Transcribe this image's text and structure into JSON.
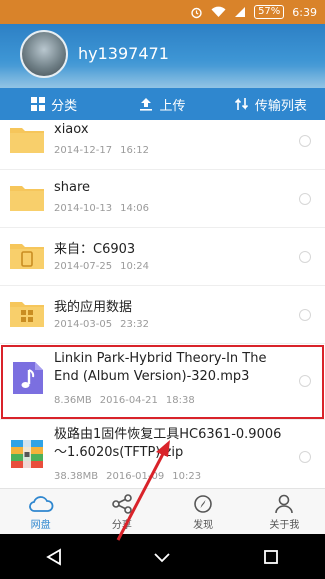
{
  "status_bar": {
    "battery": "57%",
    "time": "6:39"
  },
  "header": {
    "username": "hy1397471"
  },
  "toolbar": {
    "category": "分类",
    "upload": "上传",
    "transfer_list": "传输列表"
  },
  "files": [
    {
      "name": "xiaox",
      "date": "2014-12-17",
      "time": "16:12",
      "type": "folder"
    },
    {
      "name": "share",
      "date": "2014-10-13",
      "time": "14:06",
      "type": "folder"
    },
    {
      "name": "来自：C6903",
      "date": "2014-07-25",
      "time": "10:24",
      "type": "device-folder"
    },
    {
      "name": "我的应用数据",
      "date": "2014-03-05",
      "time": "23:32",
      "type": "app-folder"
    },
    {
      "name": "Linkin Park-Hybrid Theory-In The End (Album Version)-320.mp3",
      "size": "8.36MB",
      "date": "2016-04-21",
      "time": "18:38",
      "type": "audio"
    },
    {
      "name": "极路由1固件恢复工具HC6361-0.9006～1.6020s(TFTP).zip",
      "size": "38.38MB",
      "date": "2016-01-09",
      "time": "10:23",
      "type": "zip"
    }
  ],
  "bottom_nav": {
    "netdisk": "网盘",
    "share": "分享",
    "discover": "发现",
    "about": "关于我"
  },
  "colors": {
    "status_bar": "#d9832a",
    "primary": "#2f87cf",
    "highlight": "#d9232a",
    "folder": "#f6c65b"
  }
}
